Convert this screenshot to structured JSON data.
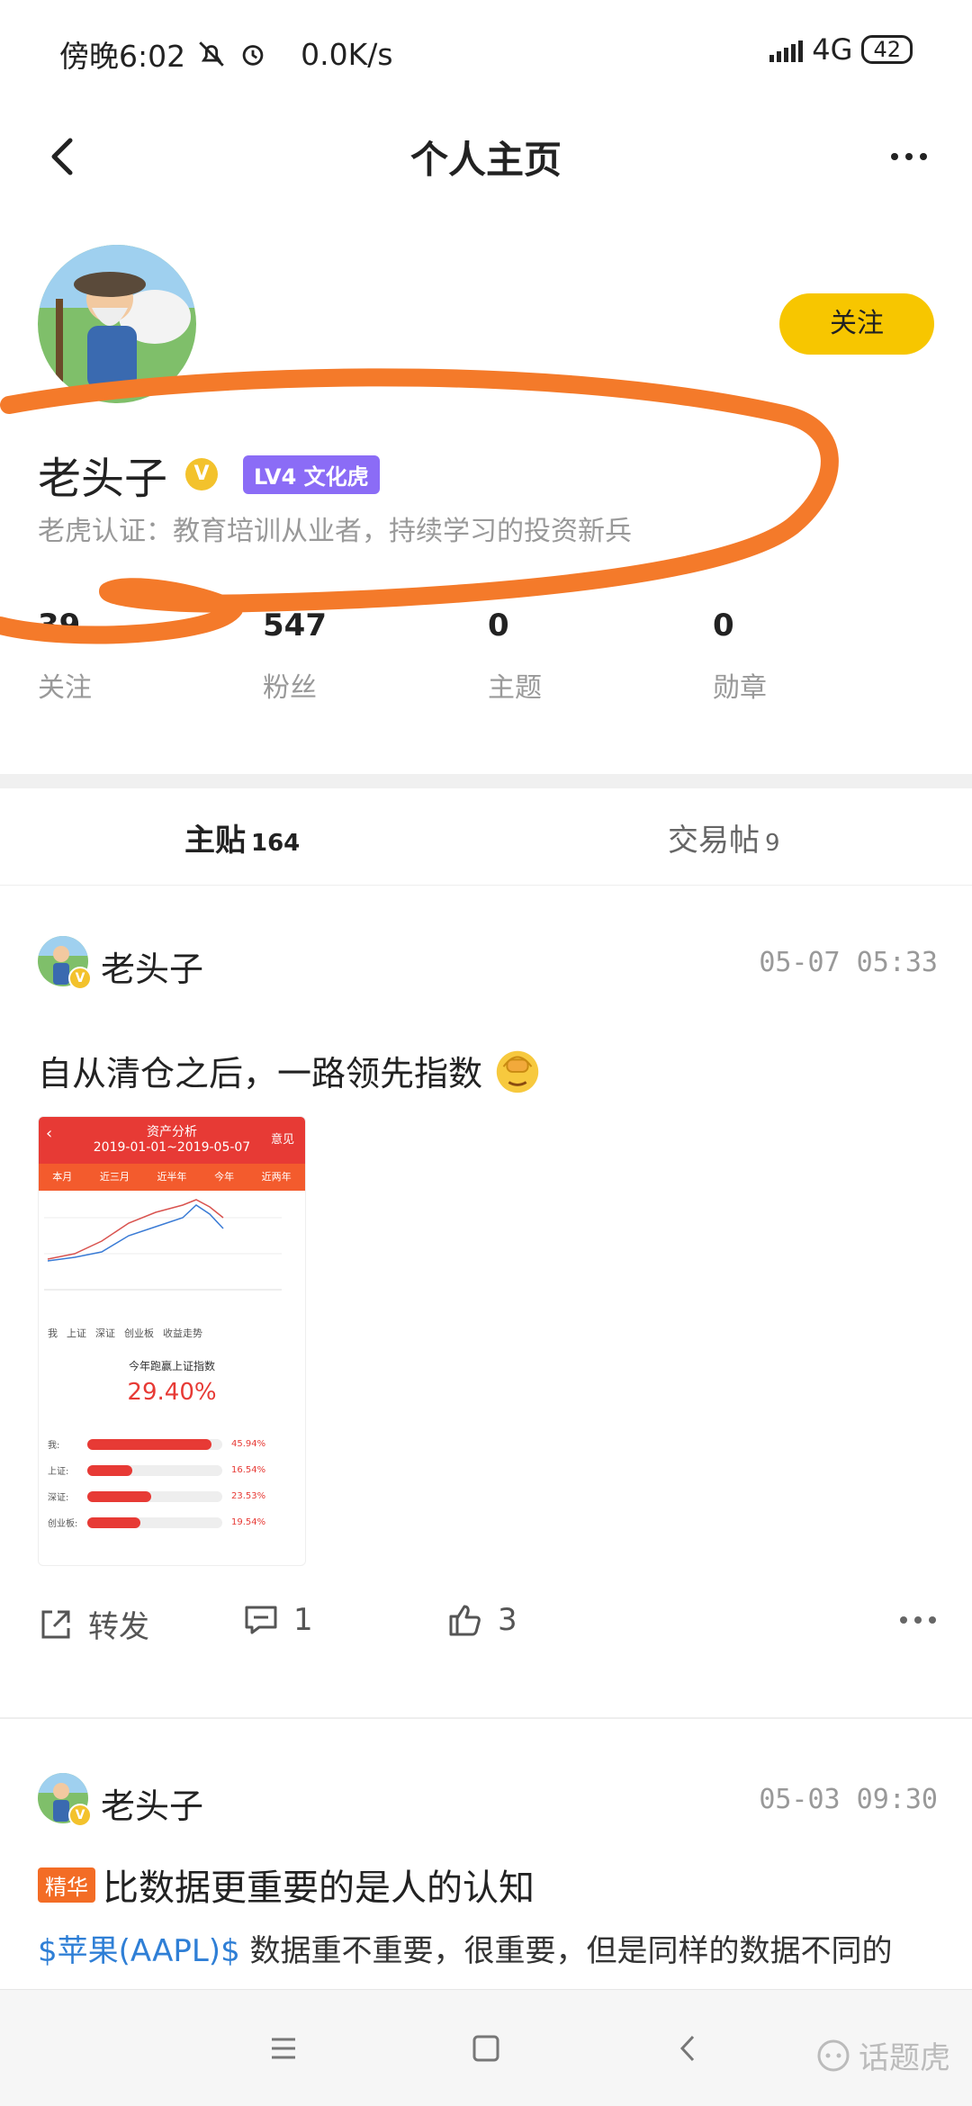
{
  "status_bar": {
    "time": "傍晚6:02",
    "speed": "0.0K/s",
    "network": "4G",
    "battery": "42"
  },
  "nav": {
    "title": "个人主页",
    "back_icon": "chevron-left-icon",
    "more_icon": "more-horizontal-icon"
  },
  "profile": {
    "name": "老头子",
    "verified_badge": "V",
    "level": "LV4 文化虎",
    "certification": "老虎认证：教育培训从业者，持续学习的投资新兵",
    "follow_button": "关注",
    "stats": [
      {
        "value": "39",
        "label": "关注"
      },
      {
        "value": "547",
        "label": "粉丝"
      },
      {
        "value": "0",
        "label": "主题"
      },
      {
        "value": "0",
        "label": "勋章"
      }
    ]
  },
  "tabs": [
    {
      "label": "主贴",
      "count": "164",
      "active": true
    },
    {
      "label": "交易帖",
      "count": "9",
      "active": false
    }
  ],
  "posts": [
    {
      "author": "老头子",
      "time": "05-07 05:33",
      "text": "自从清仓之后，一路领先指数",
      "image": {
        "header_title": "资产分析",
        "date_range": "2019-01-01~2019-05-07",
        "header_action": "意见",
        "period_tabs": [
          "本月",
          "近三月",
          "近半年",
          "今年",
          "近两年"
        ],
        "options": [
          "我",
          "上证",
          "深证",
          "创业板",
          "收益走势"
        ],
        "caption": "今年跑赢上证指数",
        "percent": "29.40%",
        "bars": [
          {
            "label": "我:",
            "value": "45.94%",
            "fraction": 0.92
          },
          {
            "label": "上证:",
            "value": "16.54%",
            "fraction": 0.33
          },
          {
            "label": "深证:",
            "value": "23.53%",
            "fraction": 0.47
          },
          {
            "label": "创业板:",
            "value": "19.54%",
            "fraction": 0.39
          }
        ]
      },
      "share_label": "转发",
      "comment_count": "1",
      "like_count": "3"
    },
    {
      "author": "老头子",
      "time": "05-03 09:30",
      "tag": "精华",
      "title": "比数据更重要的是人的认知",
      "stock": "$苹果(AAPL)$",
      "body": " 数据重不重要，很重要，但是同样的数据不同的"
    }
  ],
  "watermark": "话题虎",
  "colors": {
    "follow_button": "#f7c600",
    "level_badge": "#8b6cf6",
    "accent_red": "#e73a35",
    "link_blue": "#2f7fd6",
    "scribble": "#f47a2a"
  }
}
